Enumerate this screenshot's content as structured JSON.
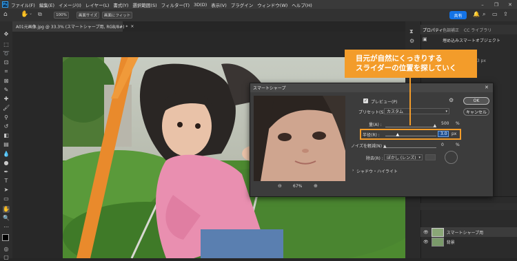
{
  "menu": {
    "logo": "Ps",
    "items": [
      "ファイル(F)",
      "編集(E)",
      "イメージ(I)",
      "レイヤー(L)",
      "書式(Y)",
      "選択範囲(S)",
      "フィルター(T)",
      "3D(D)",
      "表示(V)",
      "プラグイン",
      "ウィンドウ(W)",
      "ヘルプ(H)"
    ]
  },
  "options_bar": {
    "zoom_100": "100%",
    "fit_screen": "画面サイズ",
    "fill_screen": "画面にフィット",
    "share": "共有"
  },
  "document_tab": {
    "title": "A01元画像.jpg @ 33.3% (スマートシャープ用, RGB/8#) *",
    "close": "×"
  },
  "properties": {
    "tab_properties": "プロパティ",
    "tab_color": "色調補正",
    "tab_cc": "CC ライブラリ",
    "smart_object": "埋め込みスマートオブジェクト",
    "px_value": "33 px"
  },
  "dialog": {
    "title": "スマートシャープ",
    "preview_label": "プレビュー(P)",
    "ok": "OK",
    "cancel": "キャンセル",
    "preset_label": "プリセット(S) :",
    "preset_value": "カスタム",
    "amount_label": "量(A) :",
    "amount_value": "500",
    "amount_unit": "%",
    "amount_fraction": 0.98,
    "radius_label": "半径(R) :",
    "radius_value": "3.0",
    "radius_unit": "px",
    "radius_fraction": 0.25,
    "noise_label": "ノイズを軽減(N) :",
    "noise_value": "0",
    "noise_unit": "%",
    "noise_fraction": 0.0,
    "remove_label": "除去(R) :",
    "remove_value": "ぼかし (レンズ)",
    "shadow_highlight": "シャドウ・ハイライト",
    "zoom_value": "67%"
  },
  "callout": {
    "line1": "目元が自然にくっきりする",
    "line2": "スライダーの位置を探していく"
  },
  "layers": {
    "layer1": "スマートシャープ用",
    "layer2": "背景"
  },
  "colors": {
    "accent": "#f39c2a",
    "blue": "#1473e6"
  }
}
